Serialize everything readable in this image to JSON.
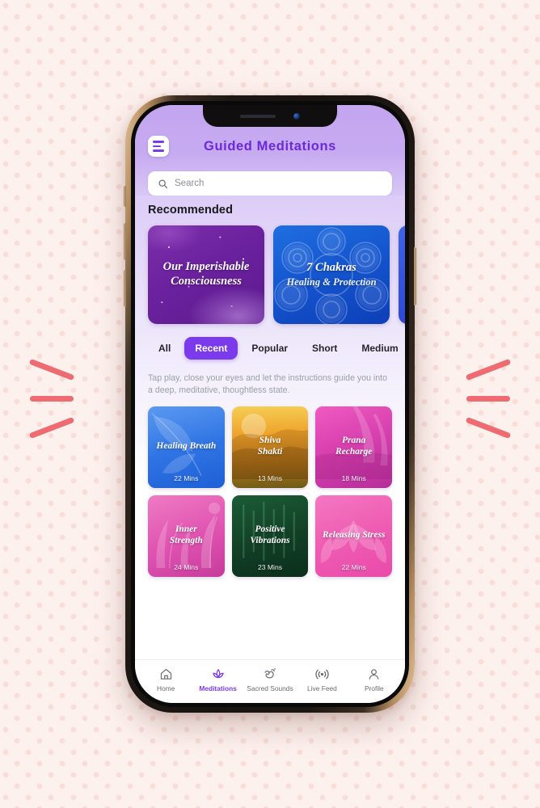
{
  "header": {
    "title": "Guided  Meditations",
    "menu_icon": "hamburger-menu-icon"
  },
  "search": {
    "placeholder": "Search",
    "value": "",
    "icon": "search-icon"
  },
  "recommended": {
    "heading": "Recommended",
    "cards": [
      {
        "title": "Our Imperishable",
        "title2": "Consciousness",
        "subtitle": "",
        "theme": "#6d22a0"
      },
      {
        "title": "7 Chakras",
        "title2": "",
        "subtitle": "Healing & Protection",
        "theme": "#1556cf"
      },
      {
        "title": "",
        "title2": "",
        "subtitle": "",
        "theme": "#2137c9"
      }
    ]
  },
  "filters": {
    "tabs": [
      {
        "label": "All",
        "active": false
      },
      {
        "label": "Recent",
        "active": true
      },
      {
        "label": "Popular",
        "active": false
      },
      {
        "label": "Short",
        "active": false
      },
      {
        "label": "Medium",
        "active": false
      }
    ],
    "active_color": "#7c3aed"
  },
  "hint": "Tap play, close your eyes and let the instructions guide you into a deep, meditative, thoughtless state.",
  "meditations": [
    {
      "title": "Healing Breath",
      "duration": "22 Mins",
      "color": "#2f74e4"
    },
    {
      "title": "Shiva\nShakti",
      "duration": "13 Mins",
      "color": "#efa32a"
    },
    {
      "title": "Prana\nRecharge",
      "duration": "18 Mins",
      "color": "#d63fae"
    },
    {
      "title": "Inner\nStrength",
      "duration": "24 Mins",
      "color": "#df52b0"
    },
    {
      "title": "Positive\nVibrations",
      "duration": "23 Mins",
      "color": "#123f26"
    },
    {
      "title": "Releasing Stress",
      "duration": "22 Mins",
      "color": "#ef5cb3"
    }
  ],
  "bottom_nav": {
    "items": [
      {
        "label": "Home",
        "icon": "home-icon",
        "active": false
      },
      {
        "label": "Meditations",
        "icon": "lotus-icon",
        "active": true
      },
      {
        "label": "Sacred Sounds",
        "icon": "om-icon",
        "active": false
      },
      {
        "label": "Live Feed",
        "icon": "broadcast-icon",
        "active": false
      },
      {
        "label": "Profile",
        "icon": "person-icon",
        "active": false
      }
    ],
    "active_color": "#7c3aed"
  },
  "decor": {
    "mark_color": "#ef6b72",
    "background_color": "#fdf1ee",
    "dot_color": "#f9ddd8"
  }
}
